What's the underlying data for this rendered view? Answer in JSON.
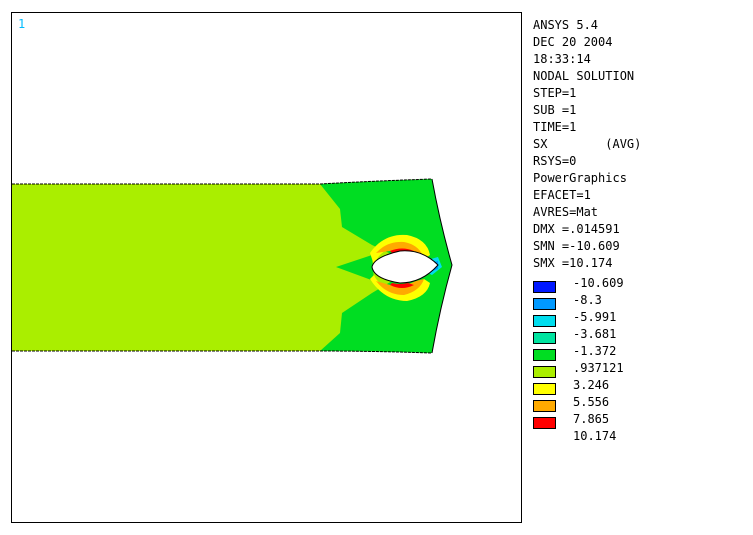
{
  "viewport": {
    "window_number": "1"
  },
  "info_lines": [
    "ANSYS 5.4",
    "DEC 20 2004",
    "18:33:14",
    "NODAL SOLUTION",
    "STEP=1",
    "SUB =1",
    "TIME=1",
    "SX        (AVG)",
    "RSYS=0",
    "PowerGraphics",
    "EFACET=1",
    "AVRES=Mat",
    "DMX =.014591",
    "SMN =-10.609",
    "SMX =10.174"
  ],
  "legend": [
    {
      "value": "-10.609",
      "color": "#0018ff"
    },
    {
      "value": "-8.3",
      "color": "#0099ff"
    },
    {
      "value": "-5.991",
      "color": "#00ddee"
    },
    {
      "value": "-3.681",
      "color": "#00e4a0"
    },
    {
      "value": "-1.372",
      "color": "#00dd22"
    },
    {
      "value": ".937121",
      "color": "#aaee00"
    },
    {
      "value": "3.246",
      "color": "#ffff00"
    },
    {
      "value": "5.556",
      "color": "#ffaa00"
    },
    {
      "value": "7.865",
      "color": "#ff0000"
    },
    {
      "value": "10.174",
      "color": null
    }
  ],
  "colors": {
    "window_number": "#00bbff",
    "background": "#ffffff",
    "outline": "#000000"
  }
}
